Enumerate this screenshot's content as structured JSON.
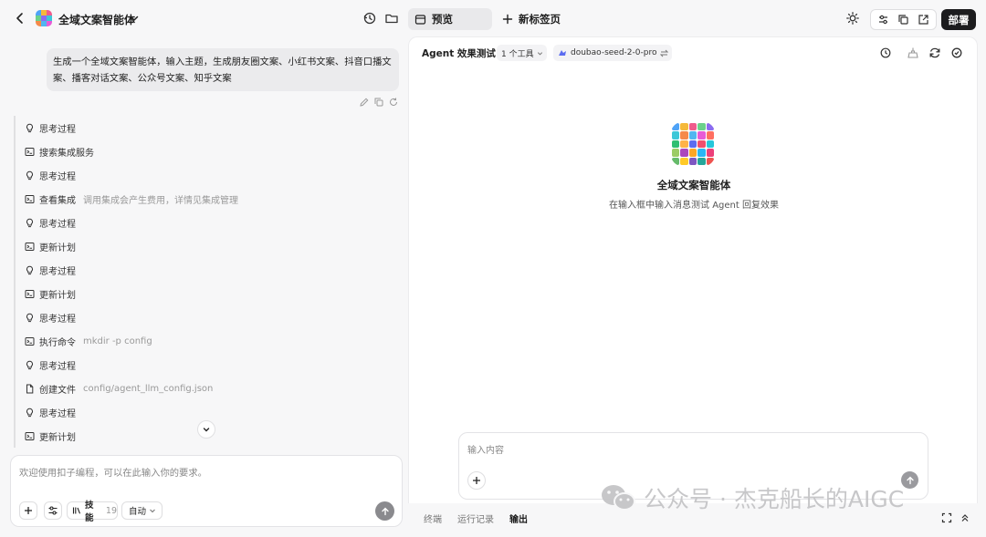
{
  "header": {
    "app_name": "全域文案智能体",
    "tab_preview": "预览",
    "new_tab": "新标签页",
    "deploy": "部署"
  },
  "chat": {
    "user_message": "生成一个全域文案智能体，输入主题，生成朋友圈文案、小红书文案、抖音口播文案、播客对话文案、公众号文案、知乎文案",
    "steps": [
      {
        "icon": "bulb-icon",
        "label": "思考过程",
        "detail": ""
      },
      {
        "icon": "terminal-icon",
        "label": "搜索集成服务",
        "detail": ""
      },
      {
        "icon": "bulb-icon",
        "label": "思考过程",
        "detail": ""
      },
      {
        "icon": "terminal-icon",
        "label": "查看集成",
        "detail": "调用集成会产生费用，详情见集成管理"
      },
      {
        "icon": "bulb-icon",
        "label": "思考过程",
        "detail": ""
      },
      {
        "icon": "terminal-icon",
        "label": "更新计划",
        "detail": ""
      },
      {
        "icon": "bulb-icon",
        "label": "思考过程",
        "detail": ""
      },
      {
        "icon": "terminal-icon",
        "label": "更新计划",
        "detail": ""
      },
      {
        "icon": "bulb-icon",
        "label": "思考过程",
        "detail": ""
      },
      {
        "icon": "terminal-icon",
        "label": "执行命令",
        "detail": "mkdir -p config"
      },
      {
        "icon": "bulb-icon",
        "label": "思考过程",
        "detail": ""
      },
      {
        "icon": "file-icon",
        "label": "创建文件",
        "detail": "config/agent_llm_config.json"
      },
      {
        "icon": "bulb-icon",
        "label": "思考过程",
        "detail": ""
      },
      {
        "icon": "terminal-icon",
        "label": "更新计划",
        "detail": ""
      }
    ],
    "input_placeholder": "欢迎使用扣子编程，可以在此输入你的要求。",
    "skill_label": "技能",
    "skill_count": "19",
    "mode_label": "自动"
  },
  "preview": {
    "title": "Agent 效果测试",
    "tool_select": "1 个工具",
    "model_select": "doubao-seed-2-0-pro",
    "agent_name": "全域文案智能体",
    "agent_hint": "在输入框中输入消息测试 Agent 回复效果",
    "input_placeholder": "输入内容"
  },
  "bottom_tabs": [
    "终端",
    "运行记录",
    "输出"
  ],
  "active_bottom_tab": "输出",
  "watermark": "公众号 · 杰克船长的AIGC",
  "colors": {
    "deploy_bg": "#1c1c1e",
    "accent": "#5b6cf0"
  }
}
